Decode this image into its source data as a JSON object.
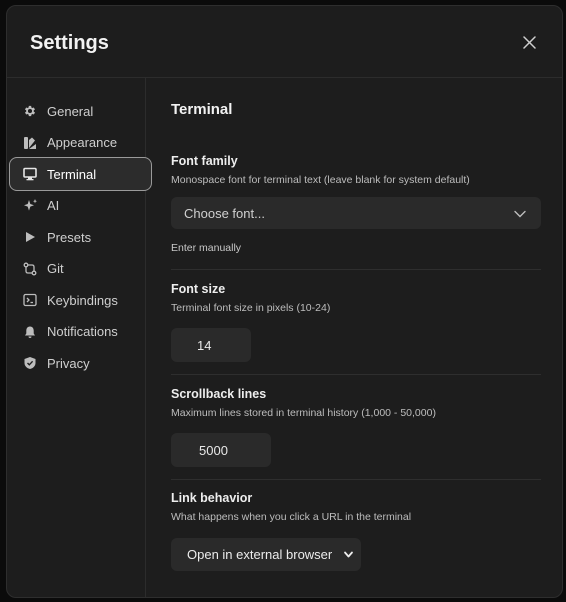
{
  "dialog": {
    "title": "Settings"
  },
  "sidebar": {
    "items": [
      {
        "label": "General",
        "icon": "gear-icon"
      },
      {
        "label": "Appearance",
        "icon": "palette-icon"
      },
      {
        "label": "Terminal",
        "icon": "monitor-icon",
        "active": true
      },
      {
        "label": "AI",
        "icon": "sparkles-icon"
      },
      {
        "label": "Presets",
        "icon": "play-icon"
      },
      {
        "label": "Git",
        "icon": "git-compare-icon"
      },
      {
        "label": "Keybindings",
        "icon": "terminal-square-icon"
      },
      {
        "label": "Notifications",
        "icon": "bell-icon"
      },
      {
        "label": "Privacy",
        "icon": "shield-check-icon"
      }
    ]
  },
  "terminal": {
    "section_title": "Terminal",
    "font_family": {
      "label": "Font family",
      "description": "Monospace font for terminal text (leave blank for system default)",
      "placeholder": "Choose font...",
      "enter_manually": "Enter manually"
    },
    "font_size": {
      "label": "Font size",
      "description": "Terminal font size in pixels (10-24)",
      "value": "14"
    },
    "scrollback": {
      "label": "Scrollback lines",
      "description": "Maximum lines stored in terminal history (1,000 - 50,000)",
      "value": "5000"
    },
    "link_behavior": {
      "label": "Link behavior",
      "description": "What happens when you click a URL in the terminal",
      "value": "Open in external browser"
    }
  },
  "colors": {
    "dialog_bg": "#1d1d1d",
    "control_bg": "#2a2a2a",
    "active_border": "#9a9a9a"
  }
}
